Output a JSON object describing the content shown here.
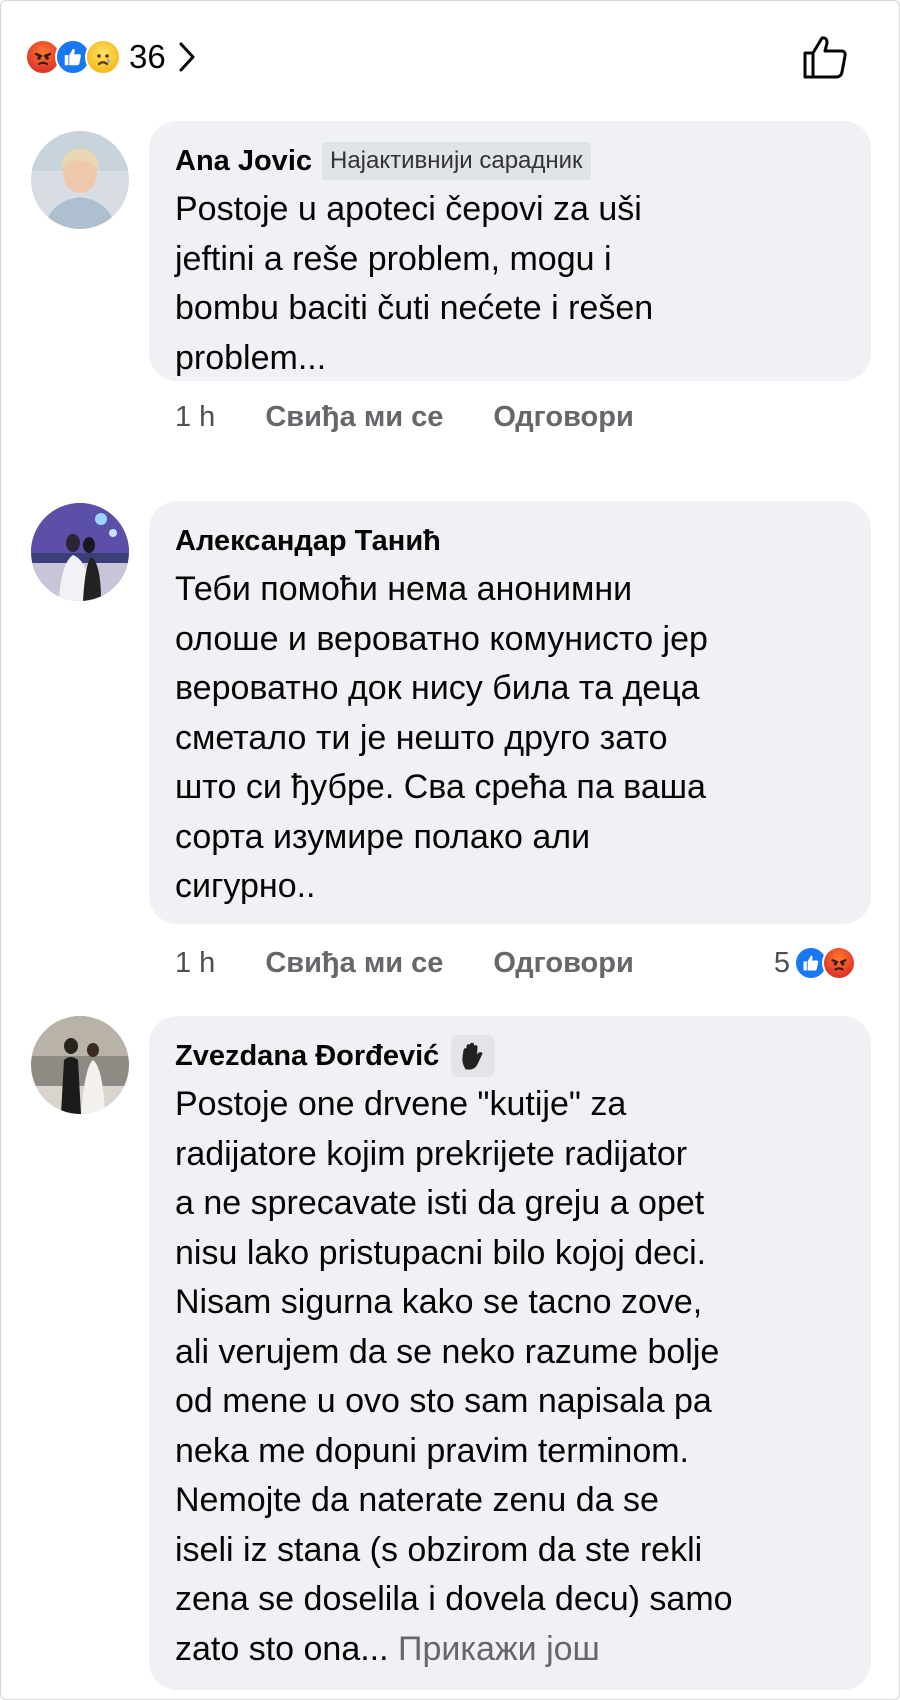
{
  "header": {
    "reactions": [
      "angry-icon",
      "like-icon",
      "sad-icon"
    ],
    "reaction_count": "36"
  },
  "comments": [
    {
      "author": "Ana Jovic",
      "badge": "Најактивнији сарадник",
      "text": "Postoje u apoteci čepovi za uši\njeftini a reše problem, mogu i\nbombu baciti čuti nećete i rešen\nproblem...",
      "time": "1 h",
      "like_label": "Свиђа ми се",
      "reply_label": "Одговори"
    },
    {
      "author": "Александар Танић",
      "text": "Теби помоћи нема анонимни\nолоше и вероватно комунисто јер\nвероватно док нису била та деца\nсметало ти је нешто друго зато\nшто си ђубре. Сва срећа па ваша\nсорта изумире полако али\nсигурно..",
      "time": "1 h",
      "like_label": "Свиђа ми се",
      "reply_label": "Одговори",
      "reaction_count": "5",
      "reactions": [
        "like-icon",
        "angry-icon"
      ]
    },
    {
      "author": "Zvezdana Đorđević",
      "badge_icon": "waving-hand-icon",
      "text": "Postoje one drvene \"kutije\" za\nradijatore kojim prekrijete radijator\na ne sprecavate isti da greju a opet\nnisu lako pristupacni bilo kojoj deci.\nNisam sigurna kako se tacno zove,\nali verujem da se neko razume bolje\nod mene u ovo sto sam napisala pa\nneka me dopuni pravim terminom.\nNemojte da naterate zenu da se\niseli iz stana (s obzirom da ste rekli\nzena se doselila i dovela decu) samo\nzato sto ona... ",
      "see_more": "Прикажи још"
    }
  ],
  "colors": {
    "bubble": "#eff1f4",
    "secondary_text": "#65676b",
    "like_blue": "#1877f2",
    "angry_red": "#e0362a"
  }
}
